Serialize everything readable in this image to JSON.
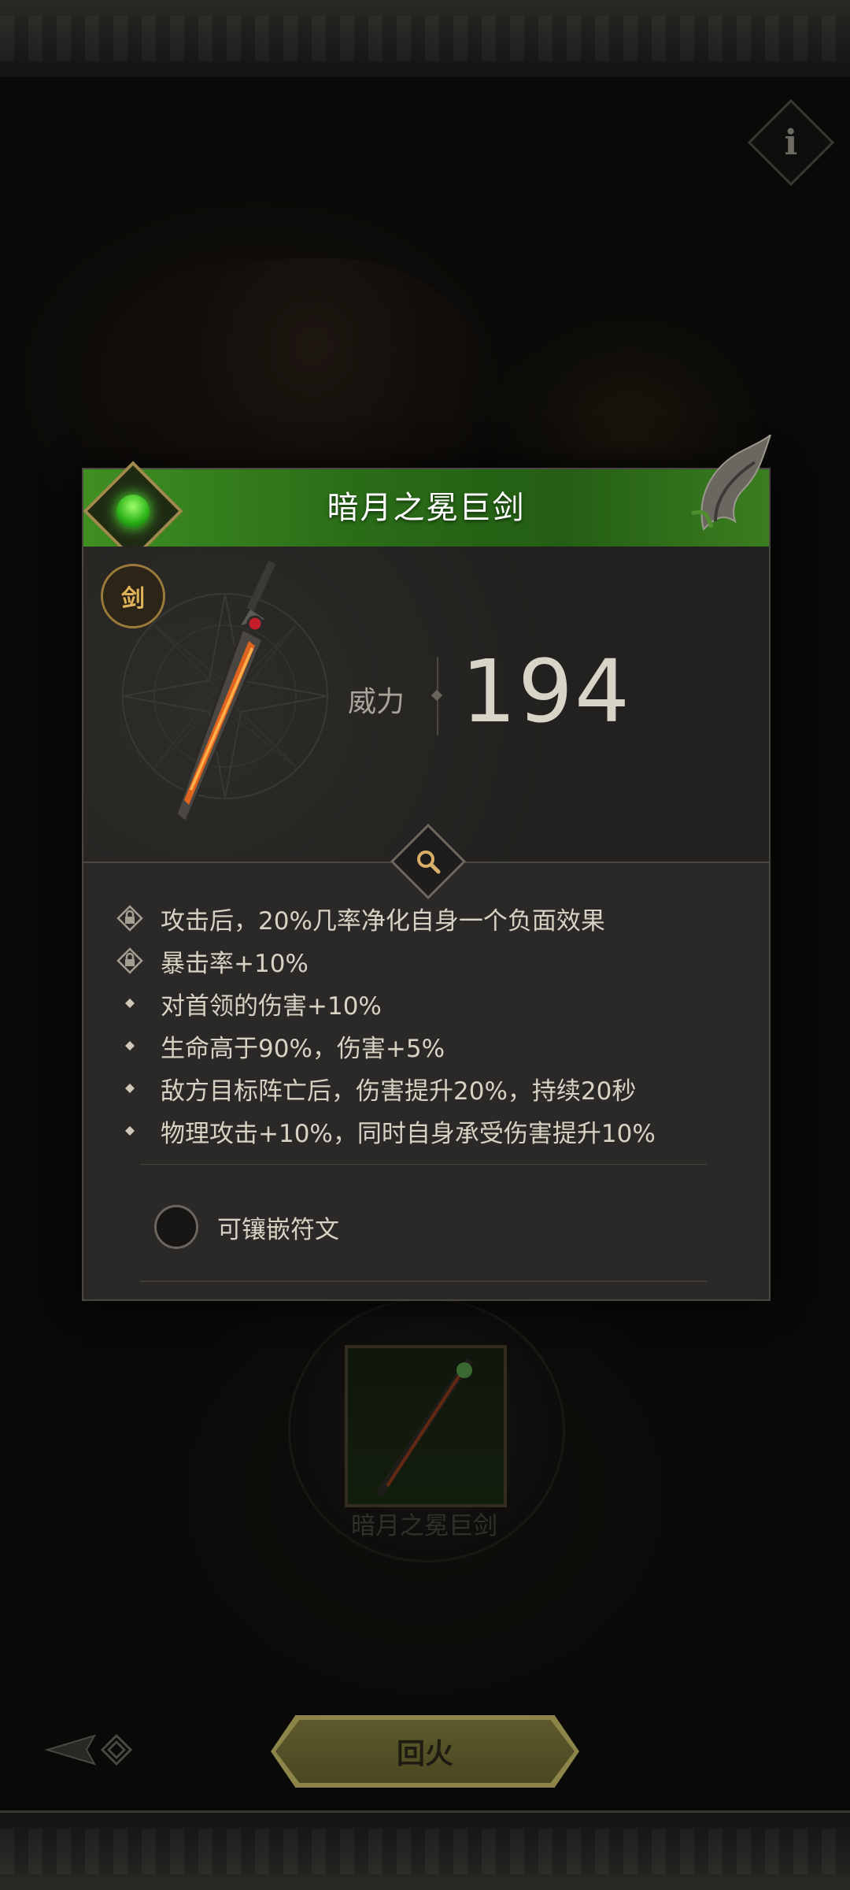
{
  "item": {
    "name": "暗月之冕巨剑",
    "type_badge": "剑",
    "stat_label": "威力",
    "stat_value": "194",
    "rarity_color": "#3f8f22"
  },
  "effects": [
    {
      "icon": "lock-icon",
      "text": "攻击后，20%几率净化自身一个负面效果"
    },
    {
      "icon": "lock-icon",
      "text": "暴击率+10%"
    },
    {
      "icon": "diamond-bullet-icon",
      "text": "对首领的伤害+10%"
    },
    {
      "icon": "diamond-bullet-icon",
      "text": "生命高于90%，伤害+5%"
    },
    {
      "icon": "diamond-bullet-icon",
      "text": "敌方目标阵亡后，伤害提升20%，持续20秒"
    },
    {
      "icon": "diamond-bullet-icon",
      "text": "物理攻击+10%，同时自身承受伤害提升10%"
    }
  ],
  "socket": {
    "label": "可镶嵌符文"
  },
  "slot": {
    "name": "暗月之冕巨剑"
  },
  "action": {
    "label": "回火"
  },
  "colors": {
    "accent_gold": "#e0b45a",
    "button": "#5e5a2c"
  }
}
